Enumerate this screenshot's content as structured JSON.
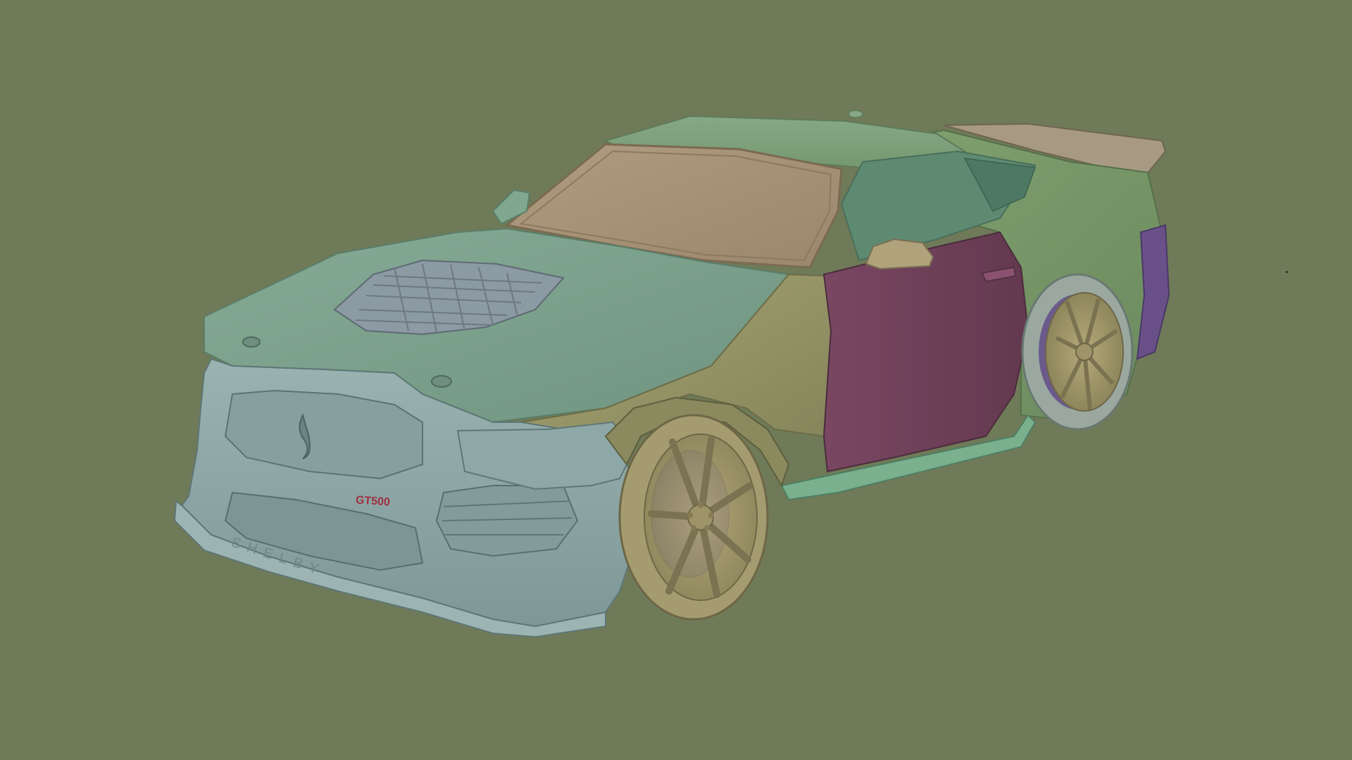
{
  "viewport": {
    "background_color": "#6f7a58",
    "mode": "3d-viewport"
  },
  "model": {
    "badge_text": "GT500",
    "lip_text": "SHELBY",
    "part_colors": {
      "front_fascia": "#8fa8a8",
      "hood": "#7aa08a",
      "roof": "#7fa184",
      "windshield": "#a89478",
      "fender": "#9a9a68",
      "door": "#6e3f58",
      "quarter_panel": "#7a9a6a",
      "wheel": "#a89e70",
      "tire": "#9aa8a0",
      "spoiler": "#a69880",
      "hood_vent": "#8c9aa4",
      "brake_caliper": "#6a5a8c",
      "mirror": "#b0a27a",
      "rocker": "#7ab08e",
      "rear_bumper": "#6a5088"
    }
  }
}
